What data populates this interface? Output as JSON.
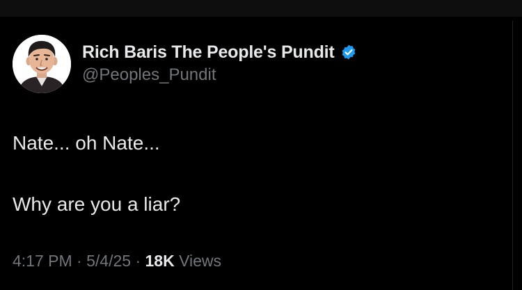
{
  "author": {
    "display_name": "Rich Baris The People's Pundit",
    "handle": "@Peoples_Pundit",
    "verified_icon": "verified-badge-icon",
    "avatar_icon": "avatar-cartoon-portrait"
  },
  "tweet": {
    "line1": "Nate... oh Nate...",
    "line2": "Why are you a liar?"
  },
  "meta": {
    "time": "4:17 PM",
    "separator1": " · ",
    "date": "5/4/25",
    "separator2": " · ",
    "views_count": "18K",
    "views_label": " Views"
  },
  "colors": {
    "background": "#000000",
    "primary_text": "#e7e9ea",
    "secondary_text": "#71767b",
    "verified_blue": "#1d9bf0"
  }
}
